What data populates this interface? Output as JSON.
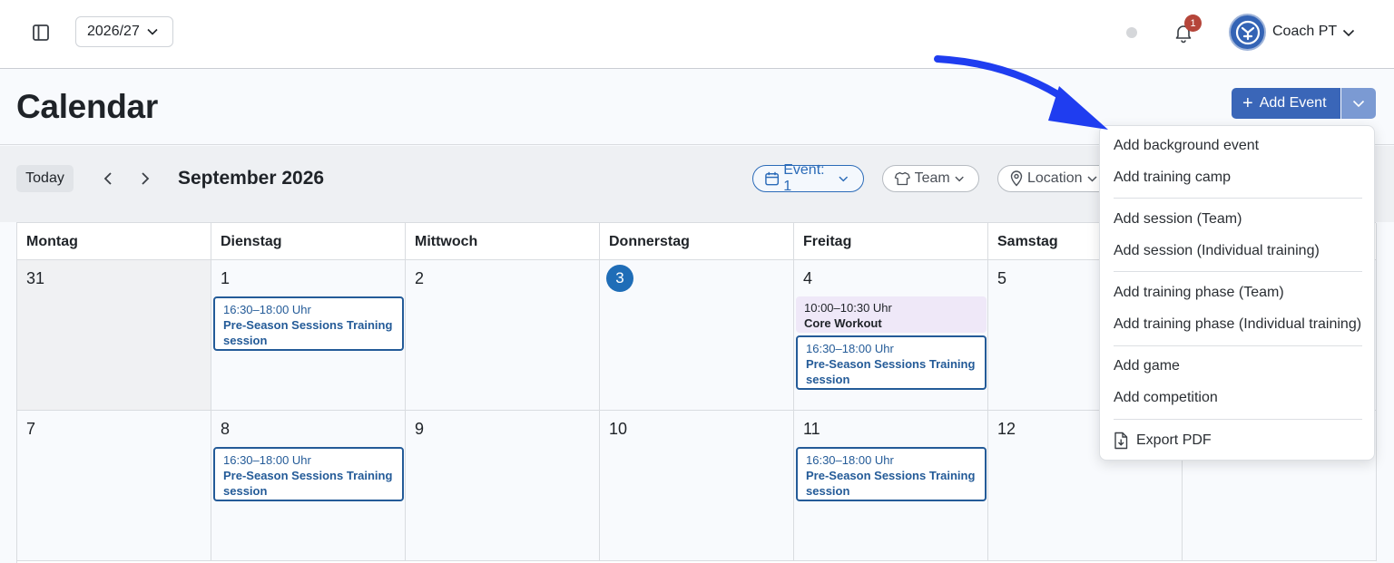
{
  "topbar": {
    "season": "2026/27",
    "notification_count": "1",
    "user_name": "Coach PT"
  },
  "header": {
    "title": "Calendar",
    "add_event_label": "Add Event"
  },
  "toolbar": {
    "today_label": "Today",
    "month_label": "September 2026",
    "filters": [
      {
        "label": "Event: 1",
        "icon": "calendar-icon",
        "active": true
      },
      {
        "label": "Team",
        "icon": "shirt-icon",
        "active": false
      },
      {
        "label": "Location",
        "icon": "location-pin-icon",
        "active": false
      }
    ]
  },
  "calendar": {
    "weekdays": [
      "Montag",
      "Dienstag",
      "Mittwoch",
      "Donnerstag",
      "Freitag",
      "Samstag"
    ],
    "weeks": [
      {
        "days": [
          "31",
          "1",
          "2",
          "3",
          "4",
          "5"
        ]
      },
      {
        "days": [
          "7",
          "8",
          "9",
          "10",
          "11",
          "12"
        ]
      }
    ],
    "today": "3",
    "events": [
      {
        "time": "16:30–18:00 Uhr",
        "title": "Pre-Season Sessions Training session"
      },
      {
        "time": "10:00–10:30 Uhr",
        "title": "Core Workout"
      },
      {
        "time": "16:30–18:00 Uhr",
        "title": "Pre-Season Sessions Training session"
      },
      {
        "time": "16:30–18:00 Uhr",
        "title": "Pre-Season Sessions Training session"
      },
      {
        "time": "16:30–18:00 Uhr",
        "title": "Pre-Season Sessions Training session"
      }
    ]
  },
  "menu": {
    "items": [
      "Add background event",
      "Add training camp",
      "Add session (Team)",
      "Add session (Individual training)",
      "Add training phase (Team)",
      "Add training phase (Individual training)",
      "Add game",
      "Add competition",
      "Export PDF"
    ]
  },
  "colors": {
    "primary": "#3a66b8",
    "event_border": "#245b98",
    "today_circle": "#1f6db7",
    "badge": "#b5453a",
    "arrow": "#1f3df0"
  }
}
